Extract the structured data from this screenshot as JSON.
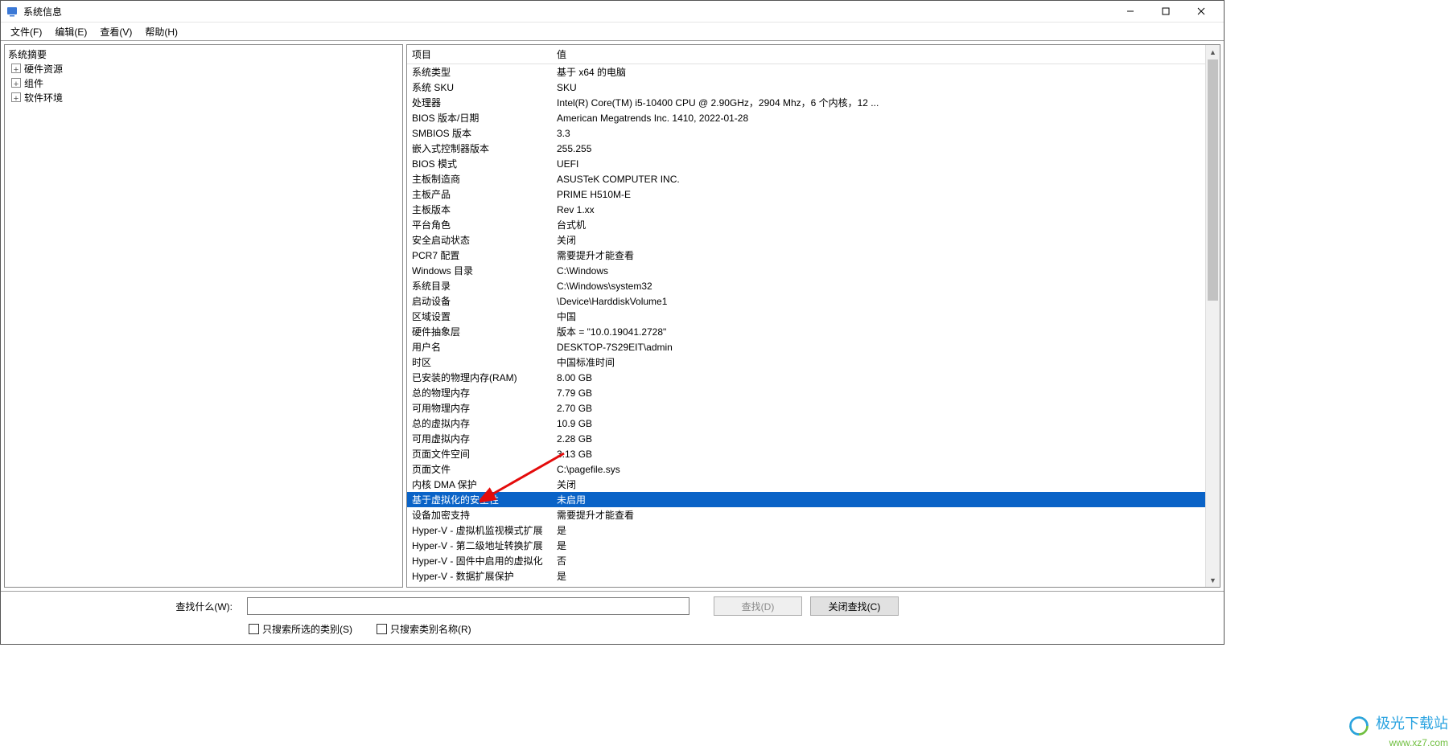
{
  "window": {
    "title": "系统信息"
  },
  "menu": {
    "file": "文件(F)",
    "edit": "编辑(E)",
    "view": "查看(V)",
    "help": "帮助(H)"
  },
  "tree": {
    "root": "系统摘要",
    "children": [
      {
        "label": "硬件资源",
        "expandable": true
      },
      {
        "label": "组件",
        "expandable": true
      },
      {
        "label": "软件环境",
        "expandable": true
      }
    ]
  },
  "columns": {
    "item": "项目",
    "value": "值"
  },
  "rows": [
    {
      "item": "系统类型",
      "value": "基于 x64 的电脑"
    },
    {
      "item": "系统 SKU",
      "value": "SKU"
    },
    {
      "item": "处理器",
      "value": "Intel(R) Core(TM) i5-10400 CPU @ 2.90GHz，2904 Mhz，6 个内核，12 ..."
    },
    {
      "item": "BIOS 版本/日期",
      "value": "American Megatrends Inc. 1410, 2022-01-28"
    },
    {
      "item": "SMBIOS 版本",
      "value": "3.3"
    },
    {
      "item": "嵌入式控制器版本",
      "value": "255.255"
    },
    {
      "item": "BIOS 模式",
      "value": "UEFI"
    },
    {
      "item": "主板制造商",
      "value": "ASUSTeK COMPUTER INC."
    },
    {
      "item": "主板产品",
      "value": "PRIME H510M-E"
    },
    {
      "item": "主板版本",
      "value": "Rev 1.xx"
    },
    {
      "item": "平台角色",
      "value": "台式机"
    },
    {
      "item": "安全启动状态",
      "value": "关闭"
    },
    {
      "item": "PCR7 配置",
      "value": "需要提升才能查看"
    },
    {
      "item": "Windows 目录",
      "value": "C:\\Windows"
    },
    {
      "item": "系统目录",
      "value": "C:\\Windows\\system32"
    },
    {
      "item": "启动设备",
      "value": "\\Device\\HarddiskVolume1"
    },
    {
      "item": "区域设置",
      "value": "中国"
    },
    {
      "item": "硬件抽象层",
      "value": "版本 = \"10.0.19041.2728\""
    },
    {
      "item": "用户名",
      "value": "DESKTOP-7S29EIT\\admin"
    },
    {
      "item": "时区",
      "value": "中国标准时间"
    },
    {
      "item": "已安装的物理内存(RAM)",
      "value": "8.00 GB"
    },
    {
      "item": "总的物理内存",
      "value": "7.79 GB"
    },
    {
      "item": "可用物理内存",
      "value": "2.70 GB"
    },
    {
      "item": "总的虚拟内存",
      "value": "10.9 GB"
    },
    {
      "item": "可用虚拟内存",
      "value": "2.28 GB"
    },
    {
      "item": "页面文件空间",
      "value": "3.13 GB"
    },
    {
      "item": "页面文件",
      "value": "C:\\pagefile.sys"
    },
    {
      "item": "内核 DMA 保护",
      "value": "关闭"
    },
    {
      "item": "基于虚拟化的安全性",
      "value": "未启用",
      "selected": true
    },
    {
      "item": "设备加密支持",
      "value": "需要提升才能查看"
    },
    {
      "item": "Hyper-V - 虚拟机监视模式扩展",
      "value": "是"
    },
    {
      "item": "Hyper-V - 第二级地址转换扩展",
      "value": "是"
    },
    {
      "item": "Hyper-V - 固件中启用的虚拟化",
      "value": "否"
    },
    {
      "item": "Hyper-V - 数据扩展保护",
      "value": "是"
    }
  ],
  "footer": {
    "search_label": "查找什么(W):",
    "search_value": "",
    "find_btn": "查找(D)",
    "close_find_btn": "关闭查找(C)",
    "check1": "只搜索所选的类别(S)",
    "check2": "只搜索类别名称(R)"
  },
  "watermark": {
    "line1": "极光下载站",
    "line2": "www.xz7.com"
  }
}
